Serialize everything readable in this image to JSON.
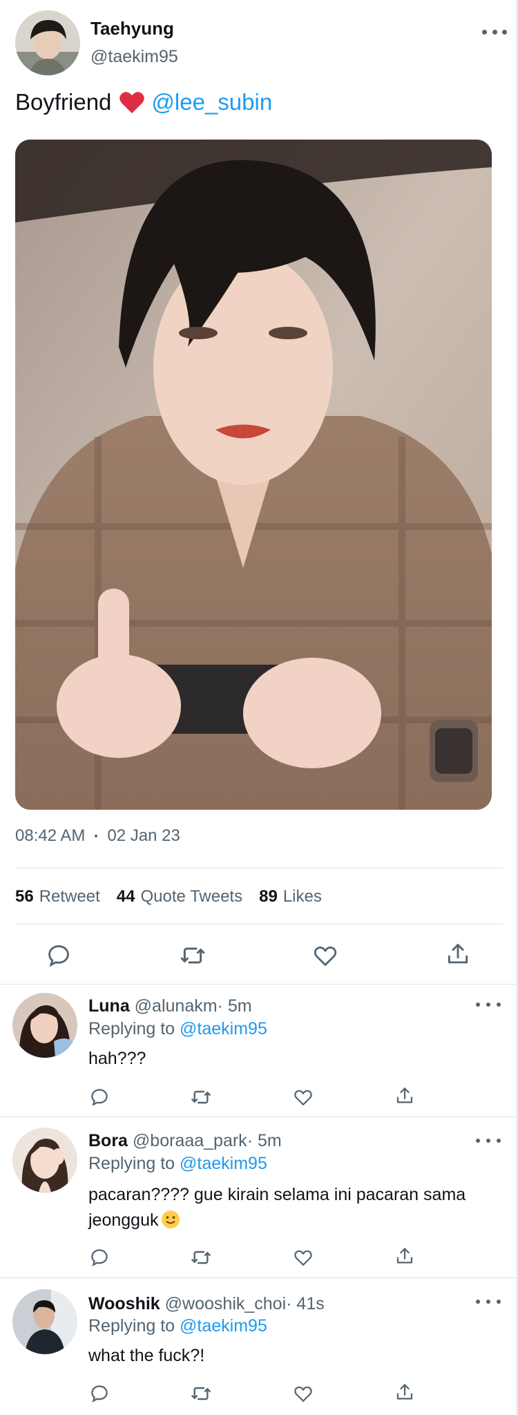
{
  "main_tweet": {
    "author_name": "Taehyung",
    "author_handle": "@taekim95",
    "text": "Boyfriend",
    "text_emoji": "red-heart",
    "mention": "@lee_subin",
    "time": "08:42 AM",
    "date": "02 Jan 23",
    "stats": {
      "retweets_count": "56",
      "retweets_label": "Retweet",
      "quotes_count": "44",
      "quotes_label": "Quote Tweets",
      "likes_count": "89",
      "likes_label": "Likes"
    }
  },
  "replies": [
    {
      "name": "Luna",
      "handle": "@alunakm",
      "separator": "·",
      "time": "5m",
      "replying_label": "Replying to",
      "replying_to": "@taekim95",
      "text": "hah???"
    },
    {
      "name": "Bora",
      "handle": "@boraaa_park",
      "separator": "·",
      "time": "5m",
      "replying_label": "Replying to",
      "replying_to": "@taekim95",
      "text": "pacaran???? gue kirain selama ini pacaran sama jeongguk",
      "text_emoji": "slightly-smiling-face"
    },
    {
      "name": "Wooshik",
      "handle": "@wooshik_choi",
      "separator": "·",
      "time": "41s",
      "replying_label": "Replying to",
      "replying_to": "@taekim95",
      "text": "what the fuck?!"
    }
  ],
  "icons": [
    "reply-icon",
    "retweet-icon",
    "like-icon",
    "share-icon",
    "more-icon"
  ],
  "colors": {
    "link": "#1d9bf0",
    "secondary_text": "#536471",
    "primary_text": "#0f1419",
    "divider": "#dde3e7",
    "heart": "#e0245e"
  }
}
